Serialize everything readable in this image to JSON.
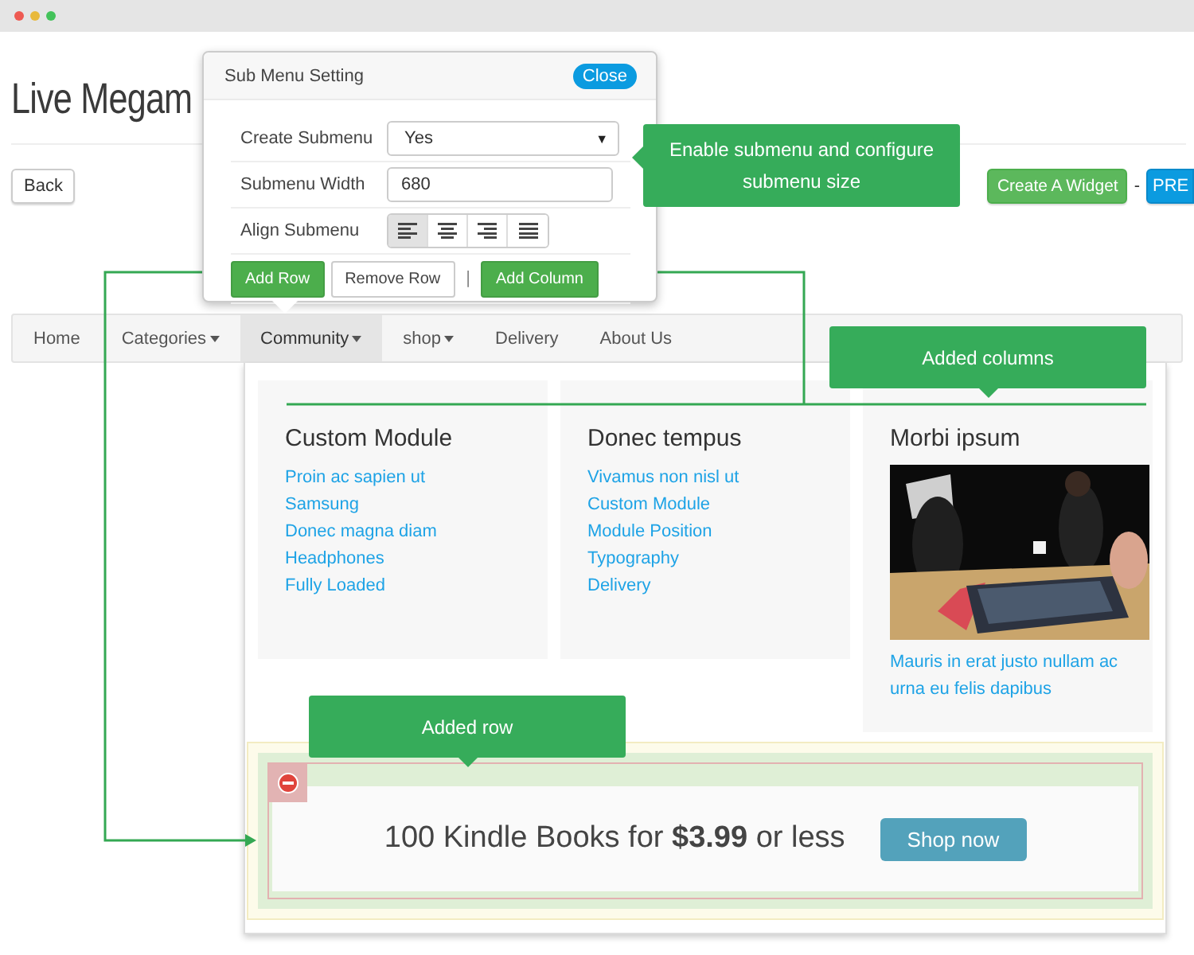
{
  "browser": {
    "dots": [
      {
        "color": "#ee5a52"
      },
      {
        "color": "#e8b93c"
      },
      {
        "color": "#43c25a"
      }
    ]
  },
  "page": {
    "title": "Live Megam",
    "back_button": "Back",
    "create_widget_button": "Create A Widget",
    "separator": "-",
    "preview_button": "PRE"
  },
  "settings_popover": {
    "title": "Sub Menu Setting",
    "close_button": "Close",
    "fields": [
      {
        "kind": "select",
        "label": "Create Submenu",
        "value": "Yes",
        "arrow": "▼"
      },
      {
        "kind": "input",
        "label": "Submenu Width",
        "value": "680"
      },
      {
        "kind": "align",
        "label": "Align Submenu",
        "options": [
          {
            "kind": "left",
            "selected": true
          },
          {
            "kind": "center",
            "selected": false
          },
          {
            "kind": "right",
            "selected": false
          },
          {
            "kind": "justify",
            "selected": false
          }
        ]
      }
    ],
    "buttons": [
      {
        "kind": "primary",
        "label": "Add Row"
      },
      {
        "kind": "default",
        "label": "Remove Row"
      },
      {
        "kind": "separator",
        "label": "|"
      },
      {
        "kind": "primary",
        "label": "Add Column"
      }
    ]
  },
  "nav": {
    "items": [
      {
        "label": "Home",
        "dropdown": false,
        "selected": false
      },
      {
        "label": "Categories",
        "dropdown": true,
        "selected": false
      },
      {
        "label": "Community",
        "dropdown": true,
        "selected": true
      },
      {
        "label": "shop",
        "dropdown": true,
        "selected": false
      },
      {
        "label": "Delivery",
        "dropdown": false,
        "selected": false
      },
      {
        "label": "About Us",
        "dropdown": false,
        "selected": false
      }
    ]
  },
  "mega_menu": {
    "columns": [
      {
        "kind": "links",
        "title": "Custom Module",
        "links": [
          "Proin ac sapien ut",
          "Samsung",
          "Donec magna diam",
          "Headphones",
          "Fully Loaded"
        ]
      },
      {
        "kind": "links",
        "title": "Donec tempus",
        "links": [
          "Vivamus non nisl ut",
          "Custom Module",
          "Module Position",
          "Typography",
          "Delivery"
        ]
      },
      {
        "kind": "picture",
        "title": "Morbi ipsum",
        "links": [
          "Mauris in erat justo nullam ac urna eu felis dapibus"
        ]
      }
    ],
    "row": {
      "text": "100 Kindle Books for **$3.99** or less",
      "button": "Shop now"
    }
  },
  "callouts": [
    {
      "kind": "left",
      "text": "Enable submenu and configure submenu size"
    },
    {
      "kind": "down",
      "text": "Added columns"
    },
    {
      "kind": "down",
      "text": "Added row"
    }
  ]
}
